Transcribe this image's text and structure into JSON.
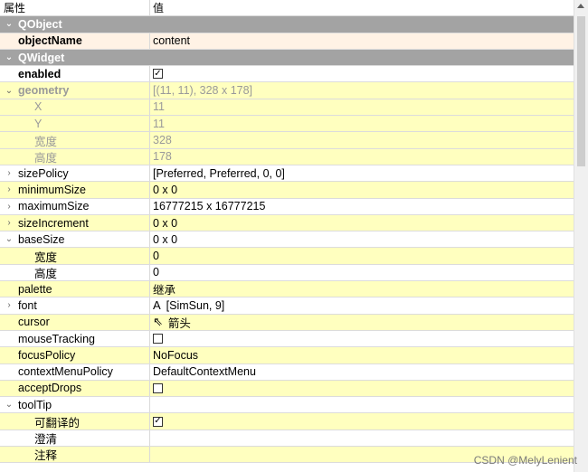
{
  "header": {
    "col_property": "属性",
    "col_value": "值"
  },
  "rows": [
    {
      "kind": "cat",
      "name": "QObject",
      "expander": "⌄"
    },
    {
      "kind": "pk",
      "name": "objectName",
      "bold": true,
      "value": "content"
    },
    {
      "kind": "cat",
      "name": "QWidget",
      "expander": "⌄"
    },
    {
      "kind": "w",
      "name": "enabled",
      "bold": true,
      "checkbox": true,
      "checked": true
    },
    {
      "kind": "y",
      "name": "geometry",
      "bold": true,
      "dim": true,
      "expander": "⌄",
      "value": "[(11, 11), 328 x 178]",
      "value_dim": true
    },
    {
      "kind": "y",
      "name": "X",
      "level": 2,
      "dim": true,
      "value": "11",
      "value_dim": true
    },
    {
      "kind": "y",
      "name": "Y",
      "level": 2,
      "dim": true,
      "value": "11",
      "value_dim": true
    },
    {
      "kind": "y",
      "name": "宽度",
      "level": 2,
      "dim": true,
      "value": "328",
      "value_dim": true
    },
    {
      "kind": "y",
      "name": "高度",
      "level": 2,
      "dim": true,
      "value": "178",
      "value_dim": true
    },
    {
      "kind": "w",
      "name": "sizePolicy",
      "expander": "›",
      "value": "[Preferred, Preferred, 0, 0]"
    },
    {
      "kind": "y",
      "name": "minimumSize",
      "expander": "›",
      "value": "0 x 0"
    },
    {
      "kind": "w",
      "name": "maximumSize",
      "expander": "›",
      "value": "16777215 x 16777215"
    },
    {
      "kind": "y",
      "name": "sizeIncrement",
      "expander": "›",
      "value": "0 x 0"
    },
    {
      "kind": "w",
      "name": "baseSize",
      "expander": "⌄",
      "value": "0 x 0"
    },
    {
      "kind": "y",
      "name": "宽度",
      "level": 2,
      "value": "0"
    },
    {
      "kind": "w",
      "name": "高度",
      "level": 2,
      "value": "0"
    },
    {
      "kind": "y",
      "name": "palette",
      "level": 1,
      "value": "继承"
    },
    {
      "kind": "w",
      "name": "font",
      "expander": "›",
      "value": "[SimSun, 9]",
      "icon": "A"
    },
    {
      "kind": "y",
      "name": "cursor",
      "level": 1,
      "value": "箭头",
      "icon": "⇖"
    },
    {
      "kind": "w",
      "name": "mouseTracking",
      "level": 1,
      "checkbox": true,
      "checked": false
    },
    {
      "kind": "y",
      "name": "focusPolicy",
      "level": 1,
      "value": "NoFocus"
    },
    {
      "kind": "w",
      "name": "contextMenuPolicy",
      "level": 1,
      "value": "DefaultContextMenu"
    },
    {
      "kind": "y",
      "name": "acceptDrops",
      "level": 1,
      "checkbox": true,
      "checked": false
    },
    {
      "kind": "w",
      "name": "toolTip",
      "expander": "⌄",
      "value": ""
    },
    {
      "kind": "y",
      "name": "可翻译的",
      "level": 2,
      "checkbox": true,
      "checked": true
    },
    {
      "kind": "w",
      "name": "澄清",
      "level": 2,
      "value": ""
    },
    {
      "kind": "y",
      "name": "注释",
      "level": 2,
      "value": ""
    }
  ],
  "watermark": "CSDN @MelyLenient",
  "icons": {
    "check": "✓",
    "scroll_up": "arrow-up-icon"
  }
}
